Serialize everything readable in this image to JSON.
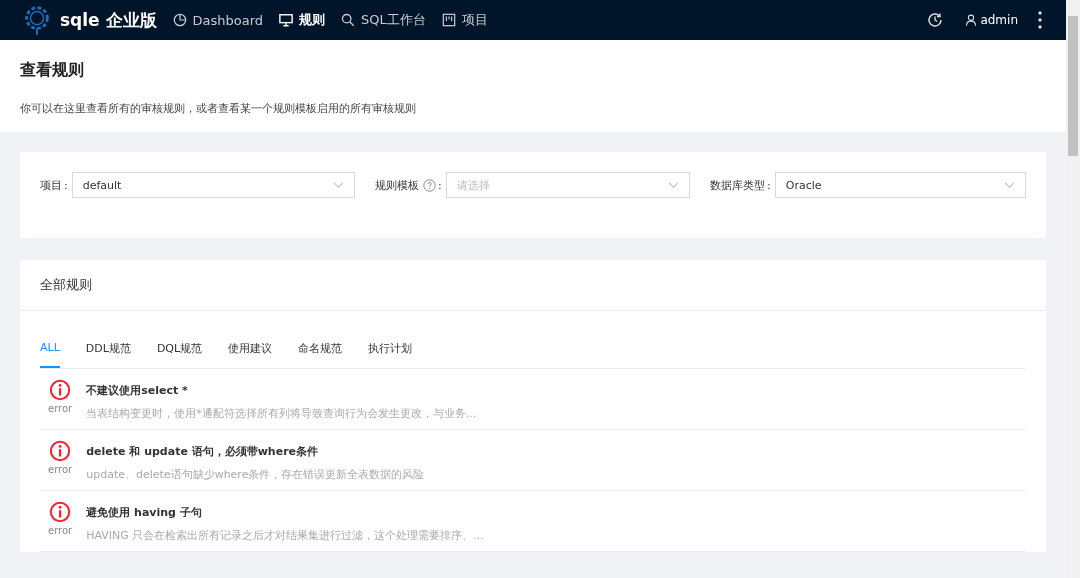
{
  "navbar": {
    "brand": "sqle 企业版",
    "items": [
      {
        "label": "Dashboard",
        "kind": "chart",
        "selected": false
      },
      {
        "label": "规则",
        "kind": "monitor",
        "selected": true
      },
      {
        "label": "SQL工作台",
        "kind": "search",
        "selected": false
      },
      {
        "label": "项目",
        "kind": "project",
        "selected": false
      }
    ],
    "user": "admin"
  },
  "header": {
    "title": "查看规则",
    "description": "你可以在这里查看所有的审核规则，或者查看某一个规则模板启用的所有审核规则"
  },
  "filters": [
    {
      "label": "项目",
      "colon": ":",
      "value": "default",
      "help": false
    },
    {
      "label": "规则模板",
      "colon": ":",
      "placeholder": "请选择",
      "help": true
    },
    {
      "label": "数据库类型",
      "colon": ":",
      "value": "Oracle",
      "help": false
    }
  ],
  "rules_card": {
    "title": "全部规则",
    "tabs": [
      {
        "label": "ALL",
        "selected": true
      },
      {
        "label": "DDL规范",
        "selected": false
      },
      {
        "label": "DQL规范",
        "selected": false
      },
      {
        "label": "使用建议",
        "selected": false
      },
      {
        "label": "命名规范",
        "selected": false
      },
      {
        "label": "执行计划",
        "selected": false
      }
    ],
    "rules": [
      {
        "level": "error",
        "title": "不建议使用select *",
        "description": "当表结构变更时，使用*通配符选择所有列将导致查询行为会发生更改，与业务..."
      },
      {
        "level": "error",
        "title": "delete 和 update 语句，必须带where条件",
        "description": "update、delete语句缺少where条件，存在错误更新全表数据的风险"
      },
      {
        "level": "error",
        "title": "避免使用 having 子句",
        "description": "HAVING 只会在检索出所有记录之后才对结果集进行过滤，这个处理需要排序、..."
      }
    ]
  }
}
